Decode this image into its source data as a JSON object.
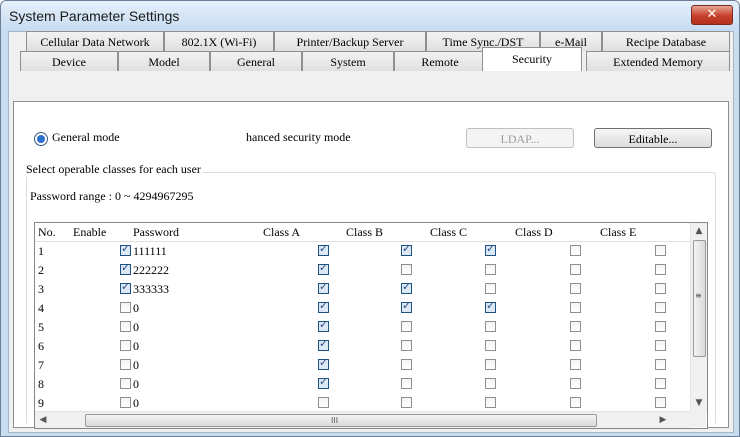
{
  "window": {
    "title": "System Parameter Settings",
    "close_glyph": "✕"
  },
  "tabs_row1": [
    "Cellular Data Network",
    "802.1X (Wi-Fi)",
    "Printer/Backup Server",
    "Time Sync./DST",
    "e-Mail",
    "Recipe Database"
  ],
  "tabs_row2": [
    "Device",
    "Model",
    "General",
    "System",
    "Remote",
    "Security",
    "Extended Memory"
  ],
  "active_tab": "Security",
  "security": {
    "mode_general": "General mode",
    "mode_enhanced": "hanced security mode",
    "ldap_button": "LDAP...",
    "editable_button": "Editable...",
    "group_label": "Select operable classes for each user",
    "password_range": "Password range : 0 ~ 4294967295"
  },
  "table": {
    "columns": [
      "No.",
      "Enable",
      "Password",
      "Class A",
      "Class B",
      "Class C",
      "Class D",
      "Class E"
    ],
    "rows": [
      {
        "no": "1",
        "enable": true,
        "password": "111111",
        "classes": [
          true,
          true,
          true,
          false,
          false
        ]
      },
      {
        "no": "2",
        "enable": true,
        "password": "222222",
        "classes": [
          true,
          false,
          false,
          false,
          false
        ]
      },
      {
        "no": "3",
        "enable": true,
        "password": "333333",
        "classes": [
          true,
          true,
          false,
          false,
          false
        ]
      },
      {
        "no": "4",
        "enable": false,
        "password": "0",
        "classes": [
          true,
          true,
          true,
          false,
          false
        ]
      },
      {
        "no": "5",
        "enable": false,
        "password": "0",
        "classes": [
          true,
          false,
          false,
          false,
          false
        ]
      },
      {
        "no": "6",
        "enable": false,
        "password": "0",
        "classes": [
          true,
          false,
          false,
          false,
          false
        ]
      },
      {
        "no": "7",
        "enable": false,
        "password": "0",
        "classes": [
          true,
          false,
          false,
          false,
          false
        ]
      },
      {
        "no": "8",
        "enable": false,
        "password": "0",
        "classes": [
          true,
          false,
          false,
          false,
          false
        ]
      },
      {
        "no": "9",
        "enable": false,
        "password": "0",
        "classes": [
          false,
          false,
          false,
          false,
          false
        ]
      }
    ]
  },
  "icons": {
    "close": "close-icon",
    "scroll_up": "▲",
    "scroll_down": "▼",
    "scroll_left": "◀",
    "scroll_right": "▶",
    "grip_v": "≡",
    "grip_h": "III"
  }
}
